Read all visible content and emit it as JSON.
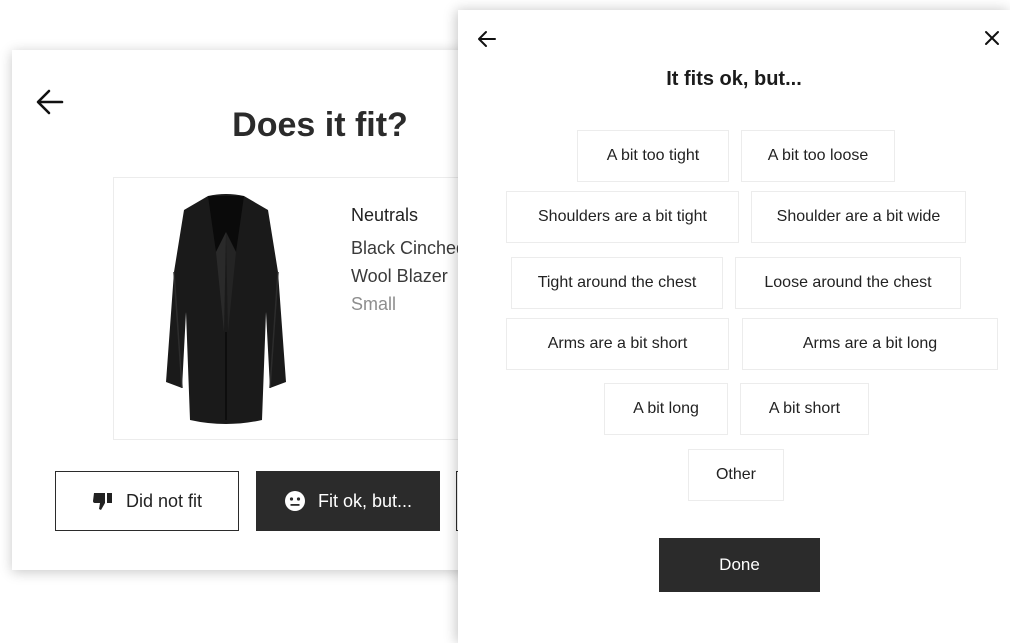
{
  "fit_card": {
    "title": "Does it fit?",
    "product": {
      "brand": "Neutrals",
      "name": "Black Cinched Wool Blazer",
      "size": "Small",
      "image_icon": "black-blazer-image"
    },
    "buttons": {
      "did_not_fit": {
        "label": "Did not fit",
        "icon": "thumbs-down-icon"
      },
      "fit_ok_but": {
        "label": "Fit ok, but...",
        "icon": "neutral-face-icon"
      }
    }
  },
  "panel": {
    "title": "It fits ok, but...",
    "options": [
      "A bit too tight",
      "A bit too loose",
      "Shoulders are a bit tight",
      "Shoulder are a bit wide",
      "Tight around the chest",
      "Loose around the chest",
      "Arms are a bit short",
      "Arms are a bit long",
      "A bit long",
      "A bit short",
      "Other"
    ],
    "done_label": "Done"
  },
  "colors": {
    "dark": "#2b2b2b",
    "chip_border": "#ececec",
    "muted_text": "#8e8e8e"
  }
}
